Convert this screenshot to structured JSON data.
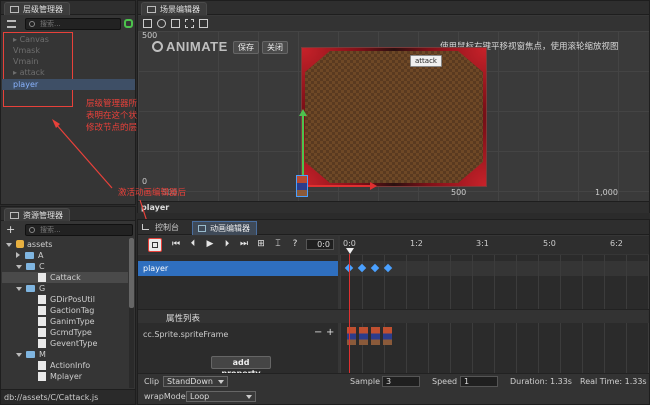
{
  "hierarchy": {
    "tab_label": "层级管理器",
    "search_placeholder": "搜索...",
    "items": [
      {
        "label": "Canvas"
      },
      {
        "label": "Vmask"
      },
      {
        "label": "Vmain"
      },
      {
        "label": "attack"
      },
      {
        "label": "player"
      }
    ],
    "annotation": {
      "line1": "层级管理器所有节点显示灰色,",
      "line2": "表明在这个状态下不能",
      "line3": "修改节点的层级"
    }
  },
  "scene": {
    "tab_label": "场景编辑器",
    "logo_text": "ANIMATE",
    "save_label": "保存",
    "close_label": "关闭",
    "hint": "使用鼠标右键平移视窗焦点，使用滚轮缩放视图",
    "attack_label": "attack",
    "y_label_top": "500",
    "y_label_zero": "0",
    "x_label_left": "500",
    "x_label_mid": "500",
    "x_label_right": "1,000"
  },
  "assets": {
    "tab_label": "资源管理器",
    "search_placeholder": "搜索...",
    "tree": [
      {
        "label": "assets"
      },
      {
        "label": "A"
      },
      {
        "label": "C"
      },
      {
        "label": "Cattack"
      },
      {
        "label": "G"
      },
      {
        "label": "GDirPosUtil"
      },
      {
        "label": "GactionTag"
      },
      {
        "label": "GanimType"
      },
      {
        "label": "GcmdType"
      },
      {
        "label": "GeventType"
      },
      {
        "label": "M"
      },
      {
        "label": "ActionInfo"
      },
      {
        "label": "Mplayer"
      }
    ],
    "status_path": "db://assets/C/Cattack.js"
  },
  "selected_node": "player",
  "annotation_animation": "激活动画编辑器后",
  "bottom": {
    "console_tab": "控制台",
    "animation_tab": "动画编辑器",
    "time_value": "0:0",
    "ruler": [
      "0:0",
      "1:2",
      "3:1",
      "5:0",
      "6:2"
    ],
    "node_row": "player",
    "property_list_title": "属性列表",
    "property": "cc.Sprite.spriteFrame",
    "add_property": "add property",
    "clip_label": "Clip",
    "clip_value": "StandDown",
    "sample_label": "Sample",
    "sample_value": "3",
    "speed_label": "Speed",
    "speed_value": "1",
    "duration_label": "Duration: 1.33s",
    "realtime_label": "Real Time: 1.33s",
    "wrap_label": "wrapMode:",
    "wrap_value": "Loop"
  },
  "colors": {
    "accent_blue": "#2f6fbf",
    "annotation_red": "#e8413a",
    "playhead_red": "#e03030",
    "keyframe_blue": "#4aa0ff"
  }
}
